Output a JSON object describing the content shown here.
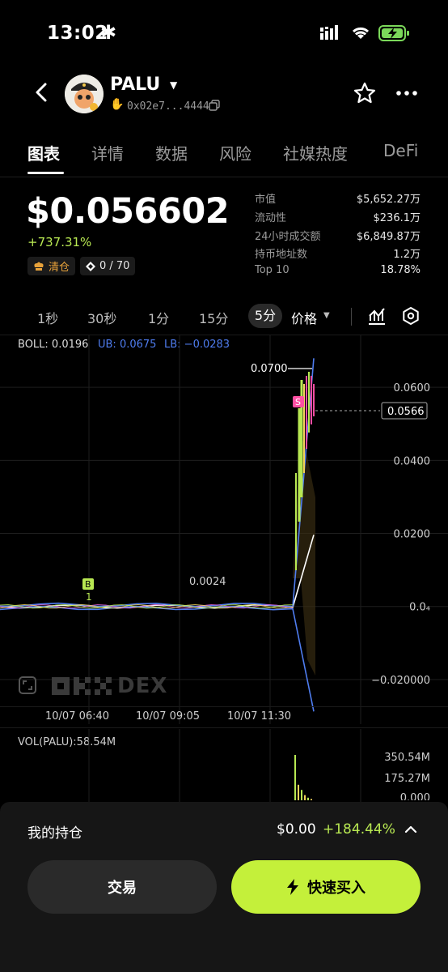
{
  "status_bar": {
    "time": "13:02",
    "time_icon": "asterisk-icon",
    "icons": [
      "cellular-signal-icon",
      "wifi-icon",
      "battery-charging-icon"
    ]
  },
  "header": {
    "token_name": "PALU",
    "address": "0x02e7...4444",
    "icons": [
      "back-icon",
      "avatar-icon",
      "dropdown-icon",
      "copy-icon",
      "star-icon",
      "more-icon"
    ]
  },
  "tabs": [
    {
      "label": "图表",
      "active": true
    },
    {
      "label": "详情"
    },
    {
      "label": "数据"
    },
    {
      "label": "风险"
    },
    {
      "label": "社媒热度"
    },
    {
      "label": "DeFi"
    }
  ],
  "price": {
    "value": "$0.056602",
    "change": "+737.31%"
  },
  "chips": {
    "clear": "清仓",
    "holders": "0 / 70"
  },
  "stats": [
    {
      "label": "市值",
      "value": "$5,652.27万"
    },
    {
      "label": "流动性",
      "value": "$236.1万"
    },
    {
      "label": "24小时成交额",
      "value": "$6,849.87万"
    },
    {
      "label": "持币地址数",
      "value": "1.2万"
    },
    {
      "label": "Top 10",
      "value": "18.78%"
    }
  ],
  "intervals": [
    "1秒",
    "30秒",
    "1分",
    "15分",
    "5分"
  ],
  "active_interval": "5分",
  "price_select": "价格",
  "boll": {
    "mid": "BOLL: 0.0196",
    "ub": "UB: 0.0675",
    "lb": "LB: −0.0283"
  },
  "chart_data": {
    "type": "line",
    "y_ticks": [
      "0.0600",
      "0.0400",
      "0.0200",
      "0.0₄",
      "−0.020000"
    ],
    "y_tick_values": [
      0.06,
      0.04,
      0.02,
      0.0,
      -0.02
    ],
    "ylim": [
      -0.03,
      0.072
    ],
    "x_ticks": [
      "10/07 06:40",
      "10/07 09:05",
      "10/07 11:30"
    ],
    "annotations": {
      "high": "0.0700",
      "low": "0.0024",
      "current": "0.0566",
      "buy_marker": "B",
      "buy_count": "1",
      "sell_marker": "S"
    },
    "series": [
      {
        "name": "BOLL",
        "color": "#ffffff",
        "values": [
          0.0,
          0.0,
          0.0,
          0.0,
          0.0,
          0.0,
          0.0,
          0.0,
          0.0,
          0.0,
          0.0,
          0.0,
          0.0,
          0.0,
          0.0,
          0.0,
          0.0196
        ]
      },
      {
        "name": "UB",
        "color": "#4f7df0",
        "values": [
          0.0,
          0.0,
          0.0,
          0.0,
          0.0,
          0.0,
          0.0,
          0.0,
          0.0,
          0.0,
          0.0,
          0.0,
          0.0,
          0.0,
          0.0,
          0.0,
          0.0675
        ]
      },
      {
        "name": "LB",
        "color": "#4f7df0",
        "values": [
          0.0,
          0.0,
          0.0,
          0.0,
          0.0,
          0.0,
          0.0,
          0.0,
          0.0,
          0.0,
          0.0,
          0.0,
          0.0,
          0.0,
          0.0,
          0.0,
          -0.0283
        ]
      }
    ]
  },
  "volume": {
    "label": "VOL(PALU):58.54M",
    "ticks": [
      "350.54M",
      "175.27M",
      "0.000"
    ],
    "values": [
      350.54,
      120.0,
      80.0,
      40.0,
      20.0,
      10.0
    ]
  },
  "logo": {
    "text": "DEX"
  },
  "holdings": {
    "label": "我的持仓",
    "value": "$0.00",
    "change": "+184.44%"
  },
  "buttons": {
    "trade": "交易",
    "buy": "快速买入"
  },
  "colors": {
    "accent": "#c4f03a",
    "positive": "#b8e852",
    "band": "#4f7df0",
    "sell": "#ff4fa3",
    "buy": "#b8e852"
  }
}
